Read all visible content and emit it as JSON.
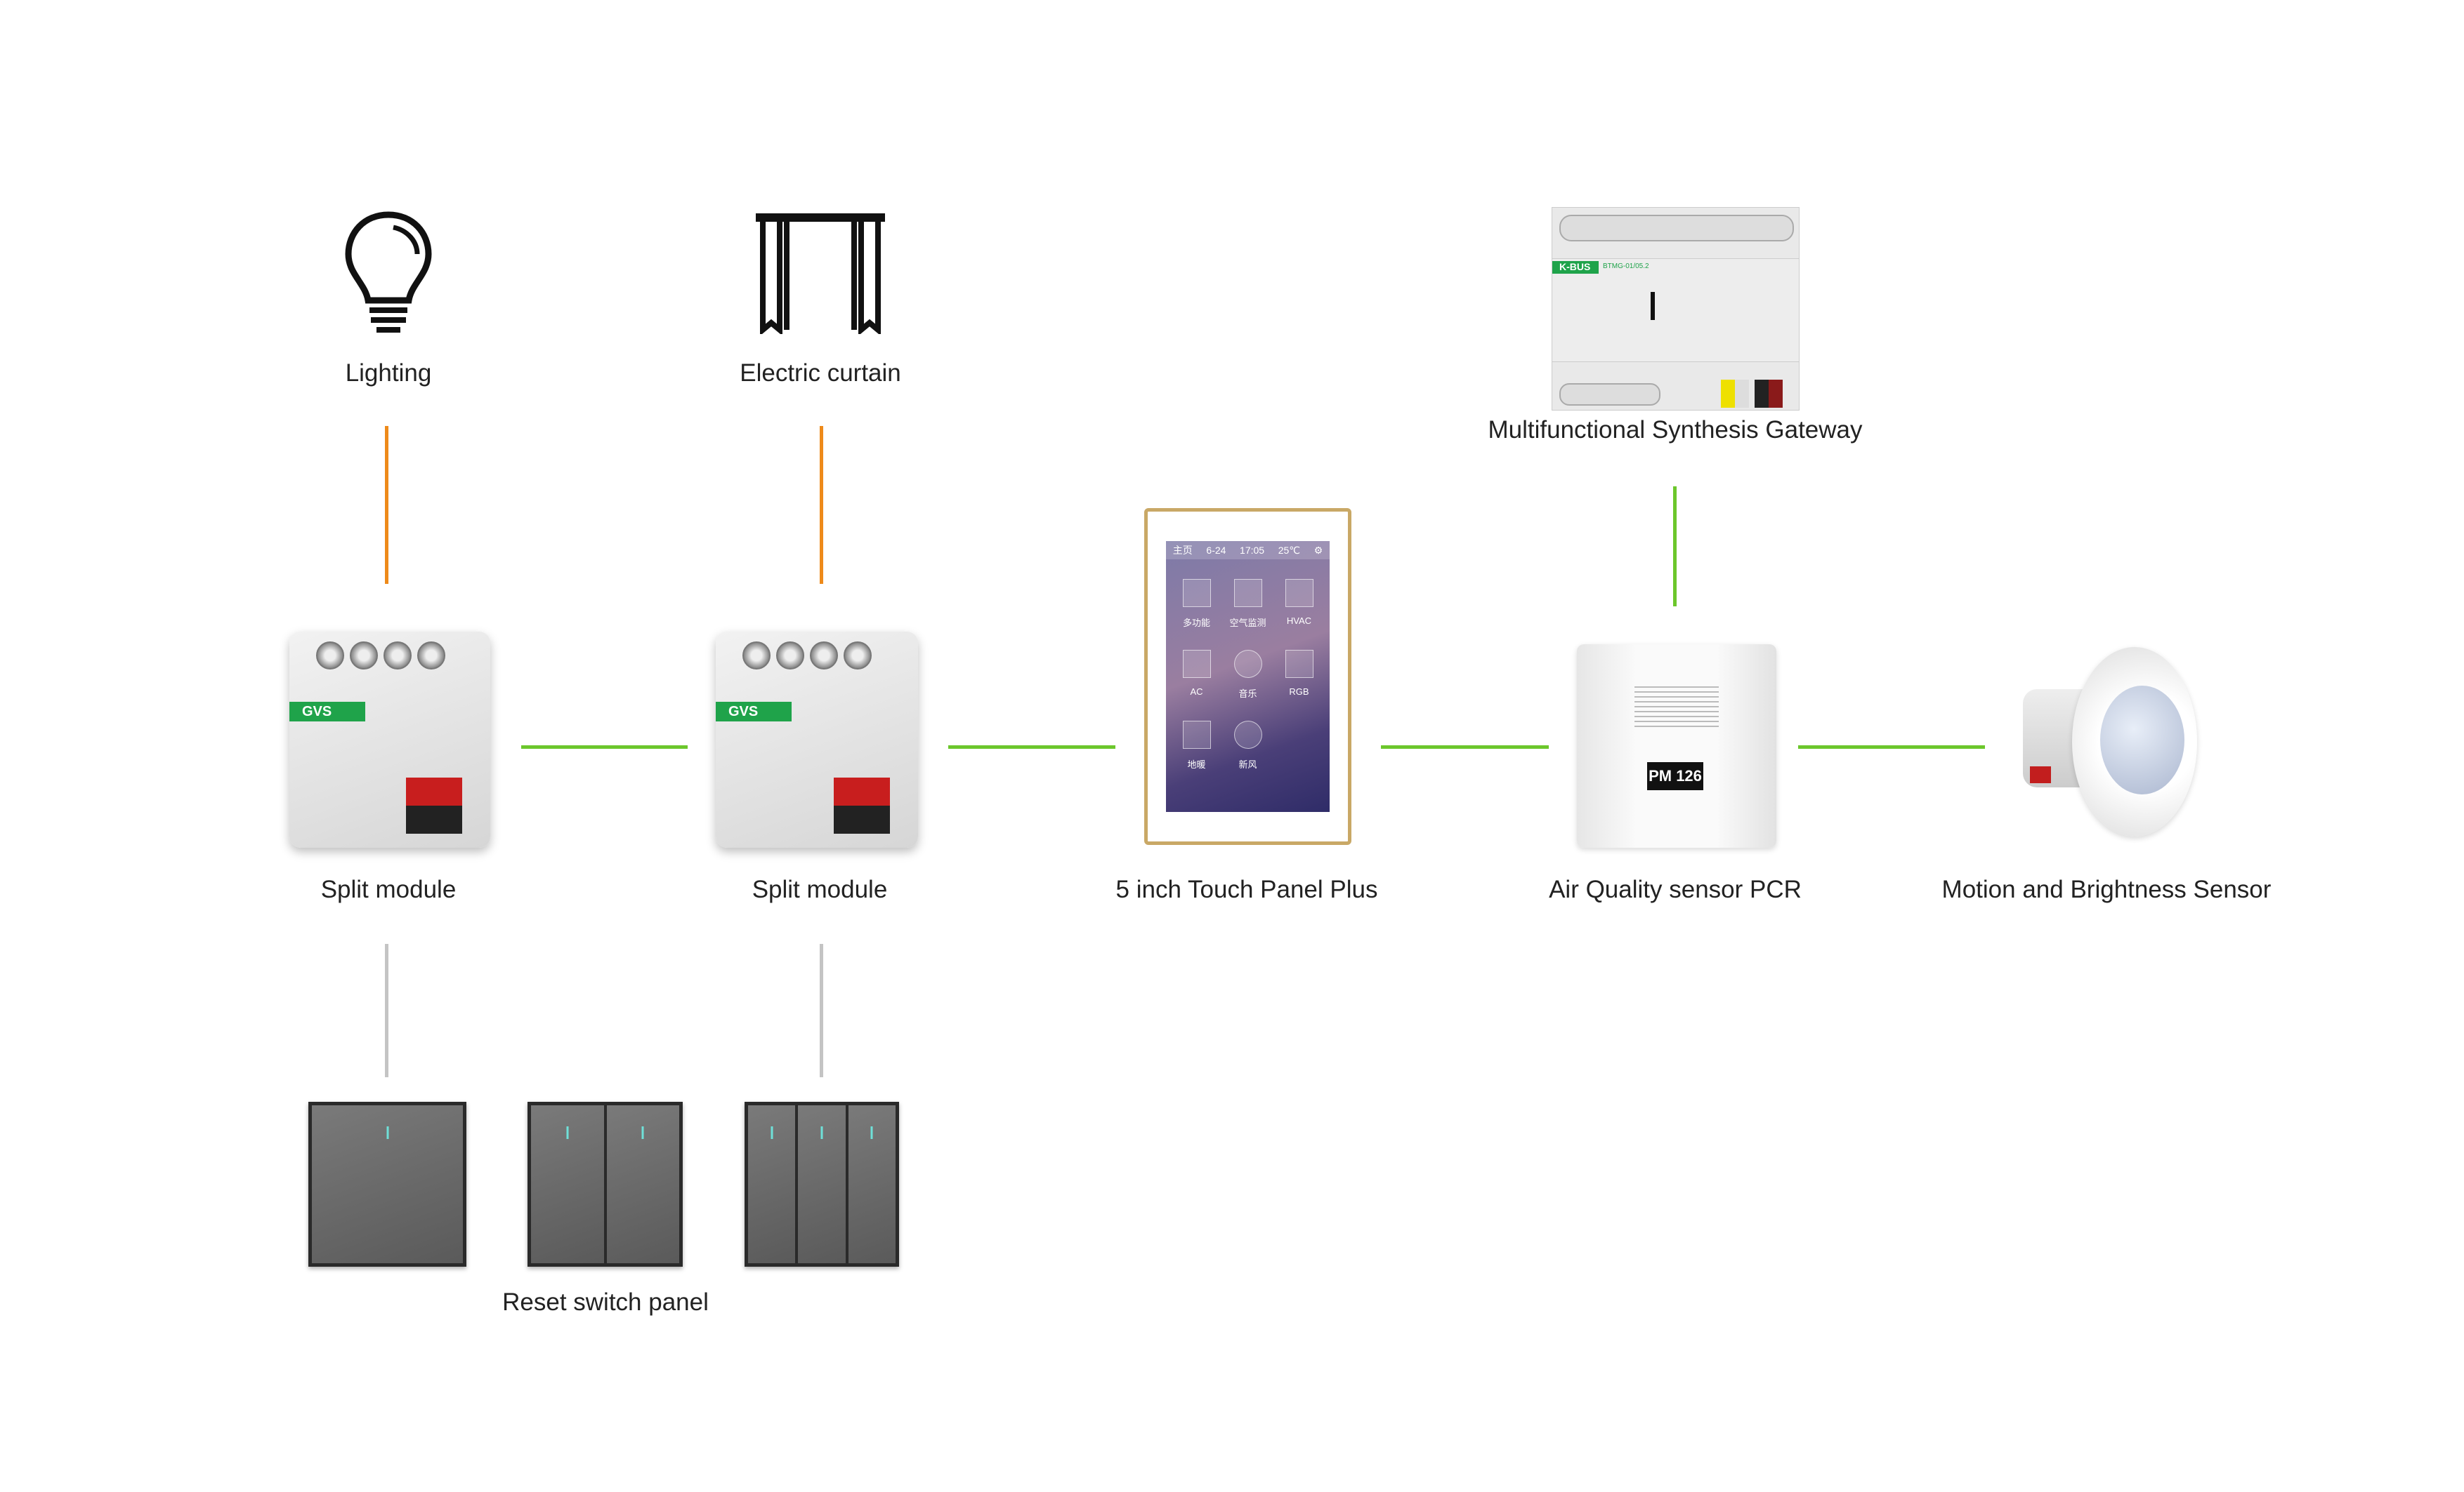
{
  "nodes": {
    "lighting": {
      "label": "Lighting",
      "icon": "light-bulb-icon"
    },
    "curtain": {
      "label": "Electric curtain",
      "icon": "curtain-icon"
    },
    "split1": {
      "label": "Split module",
      "brand": "GVS"
    },
    "split2": {
      "label": "Split module",
      "brand": "GVS"
    },
    "touch_panel": {
      "label": "5 inch Touch Panel Plus",
      "screen": {
        "home": "主页",
        "date": "6-24",
        "time": "17:05",
        "temp": "25℃",
        "apps": [
          "多功能",
          "空气监测",
          "HVAC",
          "AC",
          "音乐",
          "RGB",
          "地暖",
          "新风"
        ]
      }
    },
    "gateway": {
      "label": "Multifunctional Synthesis Gateway",
      "brand": "K-BUS",
      "model": "BTMG-01/05.2"
    },
    "air_sensor": {
      "label": "Air Quality sensor PCR",
      "display": "PM 126"
    },
    "motion_sensor": {
      "label": "Motion and Brightness Sensor"
    },
    "switches": {
      "label": "Reset switch panel"
    }
  },
  "colors": {
    "load_line": "#ee8a1a",
    "bus_line": "#6cc72c",
    "switch_line": "#c4c4c4",
    "brand_green": "#1fa34a",
    "panel_frame": "#c9a866"
  }
}
